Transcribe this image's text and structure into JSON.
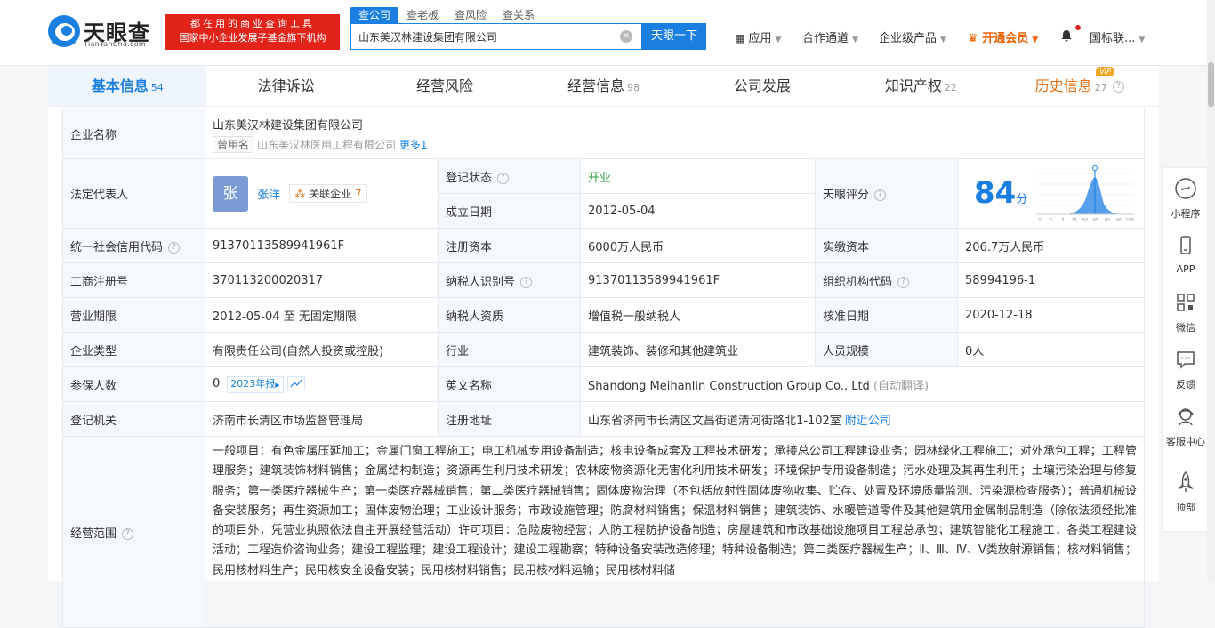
{
  "brand": {
    "name": "天眼查",
    "domain": "TianYanCha.com",
    "badge_line1": "都在用的商业查询工具",
    "badge_line2": "国家中小企业发展子基金旗下机构"
  },
  "search": {
    "tabs": [
      "查公司",
      "查老板",
      "查风险",
      "查关系"
    ],
    "value": "山东美汉林建设集团有限公司",
    "button": "天眼一下"
  },
  "topnav": {
    "apps": "应用",
    "channel": "合作通道",
    "products": "企业级产品",
    "vip": "开通会员",
    "lang": "国标联..."
  },
  "tabs": [
    {
      "label": "基本信息",
      "count": "54"
    },
    {
      "label": "法律诉讼",
      "count": ""
    },
    {
      "label": "经营风险",
      "count": ""
    },
    {
      "label": "经营信息",
      "count": "98"
    },
    {
      "label": "公司发展",
      "count": ""
    },
    {
      "label": "知识产权",
      "count": "22"
    },
    {
      "label": "历史信息",
      "count": "27",
      "vip": "VIP"
    }
  ],
  "info": {
    "company_name_label": "企业名称",
    "company_name": "山东美汉林建设集团有限公司",
    "former_tag": "曾用名",
    "former_name": "山东美汉林医用工程有限公司",
    "former_more": "更多1",
    "legal_rep_label": "法定代表人",
    "legal_rep_avatar": "张",
    "legal_rep": "张洋",
    "related_label": "关联企业",
    "related_count": "7",
    "reg_status_label": "登记状态",
    "reg_status": "开业",
    "found_date_label": "成立日期",
    "found_date": "2012-05-04",
    "score_label": "天眼评分",
    "score": "84",
    "score_unit": "分",
    "credit_code_label": "统一社会信用代码",
    "credit_code": "91370113589941961F",
    "reg_capital_label": "注册资本",
    "reg_capital": "6000万人民币",
    "paid_capital_label": "实缴资本",
    "paid_capital": "206.7万人民币",
    "biz_reg_no_label": "工商注册号",
    "biz_reg_no": "370113200020317",
    "taxpayer_id_label": "纳税人识别号",
    "taxpayer_id": "91370113589941961F",
    "org_code_label": "组织机构代码",
    "org_code": "58994196-1",
    "period_label": "营业期限",
    "period": "2012-05-04 至 无固定期限",
    "taxpayer_type_label": "纳税人资质",
    "taxpayer_type": "增值税一般纳税人",
    "approve_date_label": "核准日期",
    "approve_date": "2020-12-18",
    "company_type_label": "企业类型",
    "company_type": "有限责任公司(自然人投资或控股)",
    "industry_label": "行业",
    "industry": "建筑装饰、装修和其他建筑业",
    "staff_size_label": "人员规模",
    "staff_size": "0人",
    "insured_label": "参保人数",
    "insured": "0",
    "insured_report": "2023年报",
    "en_name_label": "英文名称",
    "en_name": "Shandong Meihanlin Construction Group Co., Ltd",
    "en_auto": "(自动翻译)",
    "authority_label": "登记机关",
    "authority": "济南市长清区市场监督管理局",
    "address_label": "注册地址",
    "address": "山东省济南市长清区文昌街道清河街路北1-102室",
    "address_link": "附近公司",
    "scope_label": "经营范围",
    "scope": "一般项目：有色金属压延加工；金属门窗工程施工；电工机械专用设备制造；核电设备成套及工程技术研发；承接总公司工程建设业务；园林绿化工程施工；对外承包工程；工程管理服务；建筑装饰材料销售；金属结构制造；资源再生利用技术研发；农林废物资源化无害化利用技术研发；环境保护专用设备制造；污水处理及其再生利用；土壤污染治理与修复服务；第一类医疗器械生产；第一类医疗器械销售；第二类医疗器械销售；固体废物治理（不包括放射性固体废物收集、贮存、处置及环境质量监测、污染源检查服务）；普通机械设备安装服务；再生资源加工；固体废物治理；工业设计服务；市政设施管理；防腐材料销售；保温材料销售；建筑装饰、水暖管道零件及其他建筑用金属制品制造（除依法须经批准的项目外，凭营业执照依法自主开展经营活动）许可项目：危险废物经营；人防工程防护设备制造；房屋建筑和市政基础设施项目工程总承包；建筑智能化工程施工；各类工程建设活动；工程造价咨询业务；建设工程监理；建设工程设计；建设工程勘察；特种设备安装改造修理；特种设备制造；第二类医疗器械生产；Ⅱ、Ⅲ、Ⅳ、Ⅴ类放射源销售；核材料销售；民用核材料生产；民用核安全设备安装；民用核材料销售；民用核材料运输；民用核材料储"
  },
  "score_chart": {
    "ticks": [
      "0",
      "1",
      "3",
      "15",
      "50",
      "65",
      "85",
      "95",
      "100"
    ]
  },
  "sidebar": {
    "miniapp": "小程序",
    "app": "APP",
    "wechat": "微信",
    "feedback": "反馈",
    "service": "客服中心",
    "top": "顶部"
  }
}
